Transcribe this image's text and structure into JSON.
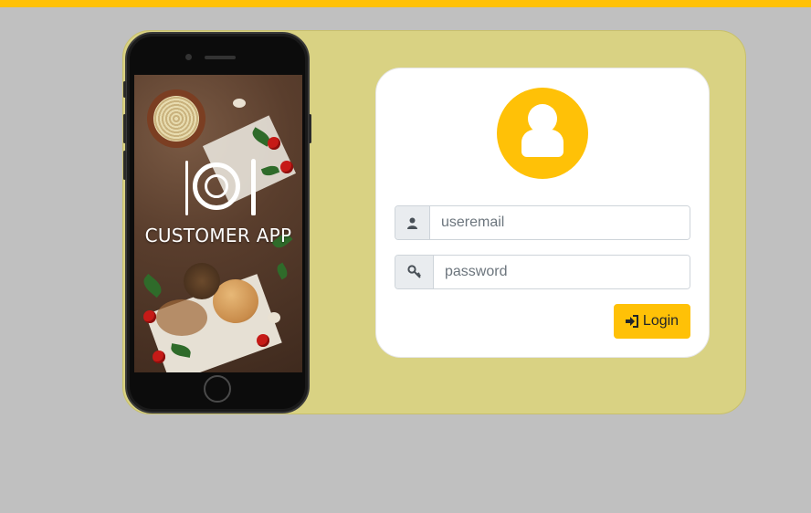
{
  "theme": {
    "accent": "#ffc107",
    "card_bg": "#d9d283",
    "page_bg": "#c0c0c0"
  },
  "phone": {
    "app_title": "CUSTOMER APP"
  },
  "login": {
    "email_placeholder": "useremail",
    "password_placeholder": "password",
    "login_label": "Login",
    "icons": {
      "avatar": "user-avatar-icon",
      "email": "user-icon",
      "password": "key-icon",
      "button": "sign-in-icon"
    }
  }
}
